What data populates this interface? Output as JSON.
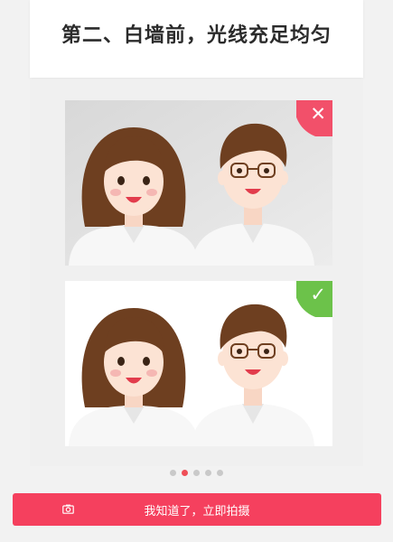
{
  "header": {
    "title": "第二、白墙前，光线充足均匀"
  },
  "examples": [
    {
      "verdict": "wrong",
      "mark": "✕",
      "mark_color": "#f2506a"
    },
    {
      "verdict": "correct",
      "mark": "✓",
      "mark_color": "#6cc24a"
    }
  ],
  "pager": {
    "total": 5,
    "active": 1
  },
  "confirm_button": {
    "label": "我知道了，立即拍摄",
    "icon": "camera-icon"
  },
  "colors": {
    "accent": "#f5405e",
    "hair": "#6e3f20",
    "shirt": "#f7f7f7",
    "skin": "#fce3d4"
  }
}
